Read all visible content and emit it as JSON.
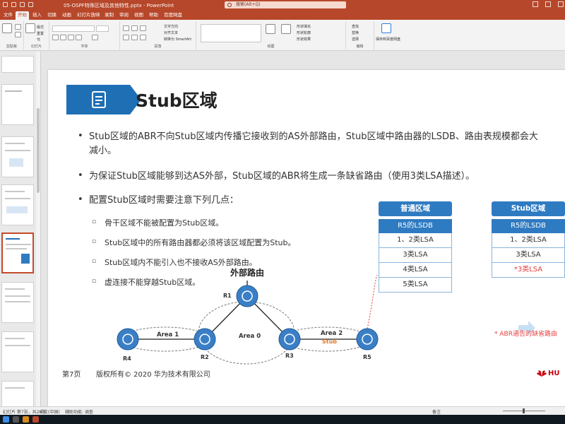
{
  "titlebar": {
    "doc_title": "05-OSPF特殊区域及其他特性.pptx - PowerPoint",
    "search_placeholder": "搜索(Alt+Q)",
    "user": ""
  },
  "tabs": [
    "文件",
    "开始",
    "插入",
    "切换",
    "动画",
    "幻灯片放映",
    "录制",
    "审阅",
    "视图",
    "帮助",
    "百度网盘"
  ],
  "ribbon": {
    "groups": [
      "剪贴板",
      "幻灯片",
      "字体",
      "段落",
      "绘图",
      "编辑",
      "保存到百度网盘"
    ],
    "labels": {
      "new_slide": "新建",
      "layout": "版式",
      "reset": "重置",
      "section": "节",
      "find": "查找",
      "replace": "替换",
      "select": "选择",
      "arrange": "排列",
      "quick_styles": "快速样式",
      "shape_fill": "形状填充",
      "shape_outline": "形状轮廓",
      "shape_effects": "形状效果",
      "text_direction": "文字方向",
      "align_text": "对齐文本",
      "smartart": "转换为 SmartArt",
      "save_baidu": "保存到百度网盘"
    }
  },
  "slide": {
    "title": "Stub区域",
    "bullets": [
      {
        "line1": "Stub区域的ABR不向Stub区域内传播它接收到的AS外部路由，Stub区域中路由器的LSDB、路由表规模都会大",
        "line2": "减小。"
      },
      {
        "line1": "为保证Stub区域能够到达AS外部，Stub区域的ABR将生成一条缺省路由（使用3类LSA描述）。"
      },
      {
        "line1": "配置Stub区域时需要注意下列几点："
      }
    ],
    "sub_bullets": [
      "骨干区域不能被配置为Stub区域。",
      "Stub区域中的所有路由器都必须将该区域配置为Stub。",
      "Stub区域内不能引入也不接收AS外部路由。",
      "虚连接不能穿越Stub区域。"
    ],
    "table_normal": {
      "header": "普通区域",
      "subheader": "R5的LSDB",
      "rows": [
        "1、2类LSA",
        "3类LSA",
        "4类LSA",
        "5类LSA"
      ]
    },
    "table_stub": {
      "header": "Stub区域",
      "subheader": "R5的LSDB",
      "rows": [
        "1、2类LSA",
        "3类LSA",
        "*3类LSA"
      ]
    },
    "note": "* ABR通告的缺省路由",
    "diagram": {
      "external_label": "外部路由",
      "routers": [
        "R1",
        "R2",
        "R3",
        "R4",
        "R5"
      ],
      "areas": [
        "Area 1",
        "Area 0",
        "Area 2"
      ],
      "stub_tag": "Stub"
    },
    "footer": {
      "page": "第7页",
      "copyright": "版权所有© 2020 华为技术有限公司",
      "brand": "HU"
    }
  },
  "status": {
    "slide_info": "幻灯片 第7张，共28张",
    "language": "中文(中国)",
    "accessibility": "辅助功能: 调查",
    "notes": "备注",
    "zoom": ""
  },
  "colors": {
    "accent": "#b7472a",
    "slide_blue": "#2f7bc2",
    "red_note": "#e34040",
    "huawei_red": "#c7000b"
  }
}
